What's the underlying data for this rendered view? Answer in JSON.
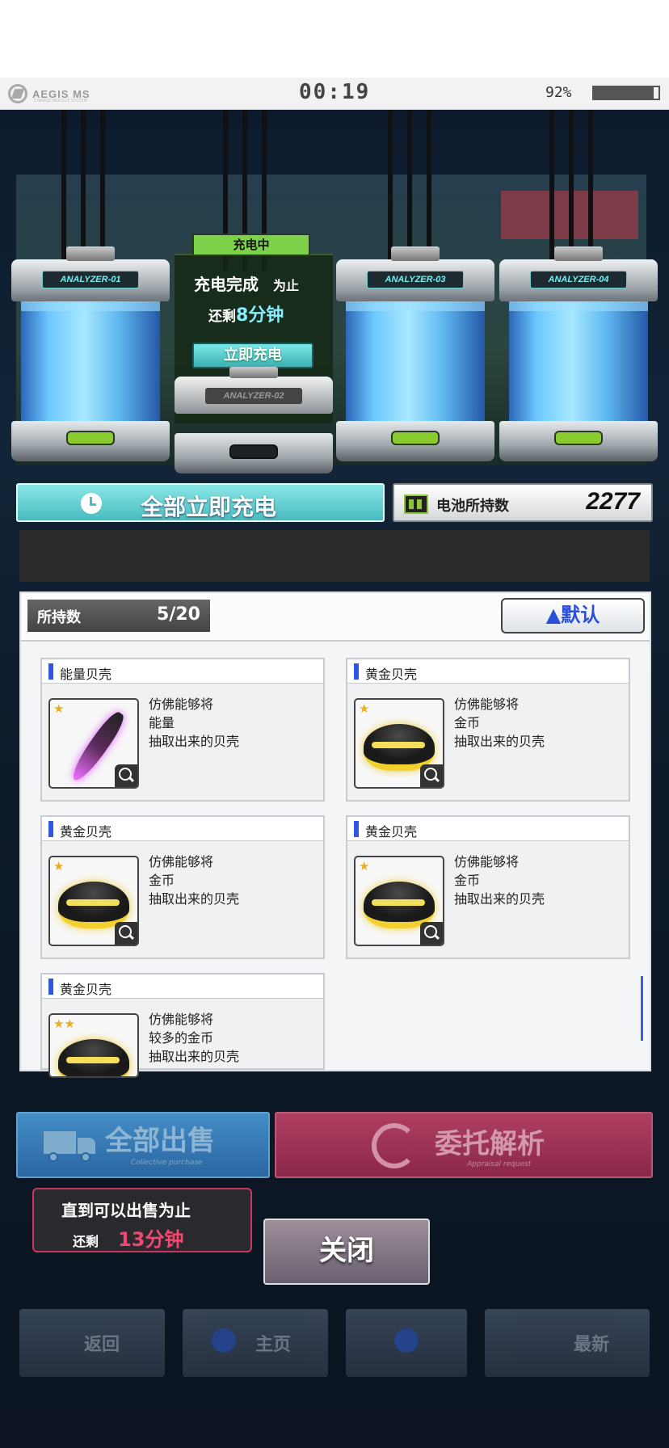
{
  "status_bar": {
    "brand": "AEGIS MS",
    "brand_sub": "CHARGE MODULE SYSTEM",
    "time": "00:19",
    "battery_pct": "92%",
    "battery_level": 0.92
  },
  "analyzers": [
    {
      "label": "ANALYZER-01"
    },
    {
      "label": "ANALYZER-02"
    },
    {
      "label": "ANALYZER-03"
    },
    {
      "label": "ANALYZER-04"
    }
  ],
  "charging": {
    "tag": "充电中",
    "line1": "充电完成",
    "line1_suffix": "为止",
    "line2_prefix": "还剩",
    "remaining": "8分钟",
    "instant_button": "立即充电"
  },
  "all_charge_button": "全部立即充电",
  "battery": {
    "label": "电池所持数",
    "value": "2277"
  },
  "inventory": {
    "count_label": "所持数",
    "count_value": "5/20",
    "sort_button": "▲默认",
    "items": [
      {
        "name": "能量贝壳",
        "stars": "★",
        "desc": [
          "仿佛能够将",
          "能量",
          "抽取出来的贝壳"
        ],
        "kind": "energy"
      },
      {
        "name": "黄金贝壳",
        "stars": "★",
        "desc": [
          "仿佛能够将",
          "金币",
          "抽取出来的贝壳"
        ],
        "kind": "gold"
      },
      {
        "name": "黄金贝壳",
        "stars": "★",
        "desc": [
          "仿佛能够将",
          "金币",
          "抽取出来的贝壳"
        ],
        "kind": "gold"
      },
      {
        "name": "黄金贝壳",
        "stars": "★",
        "desc": [
          "仿佛能够将",
          "金币",
          "抽取出来的贝壳"
        ],
        "kind": "gold"
      },
      {
        "name": "黄金贝壳",
        "stars": "★★",
        "desc": [
          "仿佛能够将",
          "较多的金币",
          "抽取出来的贝壳"
        ],
        "kind": "gold"
      }
    ]
  },
  "actions": {
    "sell_all": "全部出售",
    "sell_all_sub": "Collective purchase",
    "appraise": "委托解析",
    "appraise_sub": "Appraisal request",
    "close": "关闭"
  },
  "sell_tooltip": {
    "line1": "直到可以出售为止",
    "line2_prefix": "还剩",
    "remaining": "13分钟"
  },
  "bottom_nav": [
    "返回",
    "主页",
    "",
    "最新"
  ],
  "colors": {
    "accent_teal": "#48bcc0",
    "charging_green": "#7cd04a",
    "appraise_red": "#b03a5e",
    "sell_blue": "#3a84c4"
  }
}
